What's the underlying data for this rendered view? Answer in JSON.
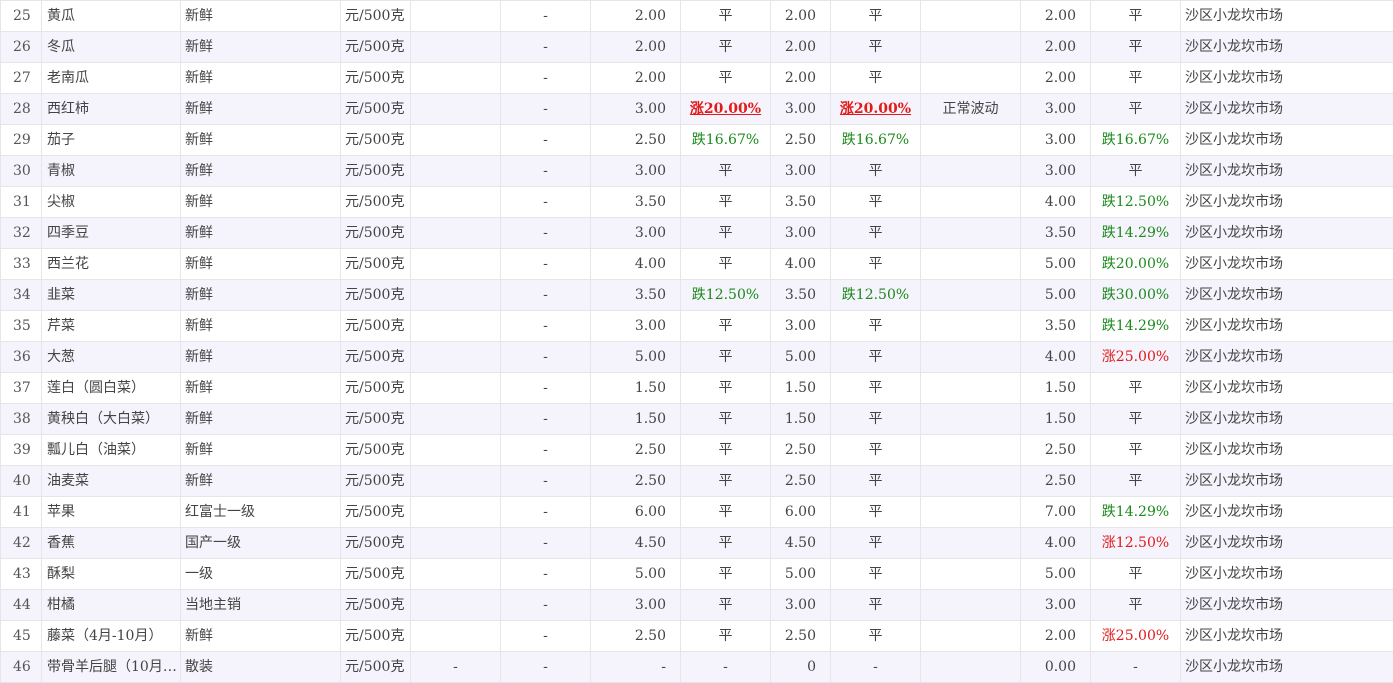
{
  "rows": [
    {
      "idx": "25",
      "name": "黄瓜",
      "spec": "新鲜",
      "unit": "元/500克",
      "b1": "",
      "b2": "-",
      "p1": "2.00",
      "c1": "平",
      "p2": "2.00",
      "c2": "平",
      "note": "",
      "p3": "2.00",
      "c3": "平",
      "market": "沙区小龙坎市场"
    },
    {
      "idx": "26",
      "name": "冬瓜",
      "spec": "新鲜",
      "unit": "元/500克",
      "b1": "",
      "b2": "-",
      "p1": "2.00",
      "c1": "平",
      "p2": "2.00",
      "c2": "平",
      "note": "",
      "p3": "2.00",
      "c3": "平",
      "market": "沙区小龙坎市场"
    },
    {
      "idx": "27",
      "name": "老南瓜",
      "spec": "新鲜",
      "unit": "元/500克",
      "b1": "",
      "b2": "-",
      "p1": "2.00",
      "c1": "平",
      "p2": "2.00",
      "c2": "平",
      "note": "",
      "p3": "2.00",
      "c3": "平",
      "market": "沙区小龙坎市场"
    },
    {
      "idx": "28",
      "name": "西红柿",
      "spec": "新鲜",
      "unit": "元/500克",
      "b1": "",
      "b2": "-",
      "p1": "3.00",
      "c1": "涨20.00%",
      "p2": "3.00",
      "c2": "涨20.00%",
      "note": "正常波动",
      "p3": "3.00",
      "c3": "平",
      "market": "沙区小龙坎市场"
    },
    {
      "idx": "29",
      "name": "茄子",
      "spec": "新鲜",
      "unit": "元/500克",
      "b1": "",
      "b2": "-",
      "p1": "2.50",
      "c1": "跌16.67%",
      "p2": "2.50",
      "c2": "跌16.67%",
      "note": "",
      "p3": "3.00",
      "c3": "跌16.67%",
      "market": "沙区小龙坎市场"
    },
    {
      "idx": "30",
      "name": "青椒",
      "spec": "新鲜",
      "unit": "元/500克",
      "b1": "",
      "b2": "-",
      "p1": "3.00",
      "c1": "平",
      "p2": "3.00",
      "c2": "平",
      "note": "",
      "p3": "3.00",
      "c3": "平",
      "market": "沙区小龙坎市场"
    },
    {
      "idx": "31",
      "name": "尖椒",
      "spec": "新鲜",
      "unit": "元/500克",
      "b1": "",
      "b2": "-",
      "p1": "3.50",
      "c1": "平",
      "p2": "3.50",
      "c2": "平",
      "note": "",
      "p3": "4.00",
      "c3": "跌12.50%",
      "market": "沙区小龙坎市场"
    },
    {
      "idx": "32",
      "name": "四季豆",
      "spec": "新鲜",
      "unit": "元/500克",
      "b1": "",
      "b2": "-",
      "p1": "3.00",
      "c1": "平",
      "p2": "3.00",
      "c2": "平",
      "note": "",
      "p3": "3.50",
      "c3": "跌14.29%",
      "market": "沙区小龙坎市场"
    },
    {
      "idx": "33",
      "name": "西兰花",
      "spec": "新鲜",
      "unit": "元/500克",
      "b1": "",
      "b2": "-",
      "p1": "4.00",
      "c1": "平",
      "p2": "4.00",
      "c2": "平",
      "note": "",
      "p3": "5.00",
      "c3": "跌20.00%",
      "market": "沙区小龙坎市场"
    },
    {
      "idx": "34",
      "name": "韭菜",
      "spec": "新鲜",
      "unit": "元/500克",
      "b1": "",
      "b2": "-",
      "p1": "3.50",
      "c1": "跌12.50%",
      "p2": "3.50",
      "c2": "跌12.50%",
      "note": "",
      "p3": "5.00",
      "c3": "跌30.00%",
      "market": "沙区小龙坎市场"
    },
    {
      "idx": "35",
      "name": "芹菜",
      "spec": "新鲜",
      "unit": "元/500克",
      "b1": "",
      "b2": "-",
      "p1": "3.00",
      "c1": "平",
      "p2": "3.00",
      "c2": "平",
      "note": "",
      "p3": "3.50",
      "c3": "跌14.29%",
      "market": "沙区小龙坎市场"
    },
    {
      "idx": "36",
      "name": "大葱",
      "spec": "新鲜",
      "unit": "元/500克",
      "b1": "",
      "b2": "-",
      "p1": "5.00",
      "c1": "平",
      "p2": "5.00",
      "c2": "平",
      "note": "",
      "p3": "4.00",
      "c3": "涨25.00%",
      "market": "沙区小龙坎市场"
    },
    {
      "idx": "37",
      "name": "莲白（圆白菜）",
      "spec": "新鲜",
      "unit": "元/500克",
      "b1": "",
      "b2": "-",
      "p1": "1.50",
      "c1": "平",
      "p2": "1.50",
      "c2": "平",
      "note": "",
      "p3": "1.50",
      "c3": "平",
      "market": "沙区小龙坎市场"
    },
    {
      "idx": "38",
      "name": "黄秧白（大白菜）",
      "spec": "新鲜",
      "unit": "元/500克",
      "b1": "",
      "b2": "-",
      "p1": "1.50",
      "c1": "平",
      "p2": "1.50",
      "c2": "平",
      "note": "",
      "p3": "1.50",
      "c3": "平",
      "market": "沙区小龙坎市场"
    },
    {
      "idx": "39",
      "name": "瓢儿白（油菜）",
      "spec": "新鲜",
      "unit": "元/500克",
      "b1": "",
      "b2": "-",
      "p1": "2.50",
      "c1": "平",
      "p2": "2.50",
      "c2": "平",
      "note": "",
      "p3": "2.50",
      "c3": "平",
      "market": "沙区小龙坎市场"
    },
    {
      "idx": "40",
      "name": "油麦菜",
      "spec": "新鲜",
      "unit": "元/500克",
      "b1": "",
      "b2": "-",
      "p1": "2.50",
      "c1": "平",
      "p2": "2.50",
      "c2": "平",
      "note": "",
      "p3": "2.50",
      "c3": "平",
      "market": "沙区小龙坎市场"
    },
    {
      "idx": "41",
      "name": "苹果",
      "spec": "红富士一级",
      "unit": "元/500克",
      "b1": "",
      "b2": "-",
      "p1": "6.00",
      "c1": "平",
      "p2": "6.00",
      "c2": "平",
      "note": "",
      "p3": "7.00",
      "c3": "跌14.29%",
      "market": "沙区小龙坎市场"
    },
    {
      "idx": "42",
      "name": "香蕉",
      "spec": "国产一级",
      "unit": "元/500克",
      "b1": "",
      "b2": "-",
      "p1": "4.50",
      "c1": "平",
      "p2": "4.50",
      "c2": "平",
      "note": "",
      "p3": "4.00",
      "c3": "涨12.50%",
      "market": "沙区小龙坎市场"
    },
    {
      "idx": "43",
      "name": "酥梨",
      "spec": "一级",
      "unit": "元/500克",
      "b1": "",
      "b2": "-",
      "p1": "5.00",
      "c1": "平",
      "p2": "5.00",
      "c2": "平",
      "note": "",
      "p3": "5.00",
      "c3": "平",
      "market": "沙区小龙坎市场"
    },
    {
      "idx": "44",
      "name": "柑橘",
      "spec": "当地主销",
      "unit": "元/500克",
      "b1": "",
      "b2": "-",
      "p1": "3.00",
      "c1": "平",
      "p2": "3.00",
      "c2": "平",
      "note": "",
      "p3": "3.00",
      "c3": "平",
      "market": "沙区小龙坎市场"
    },
    {
      "idx": "45",
      "name": "藤菜（4月-10月）",
      "spec": "新鲜",
      "unit": "元/500克",
      "b1": "",
      "b2": "-",
      "p1": "2.50",
      "c1": "平",
      "p2": "2.50",
      "c2": "平",
      "note": "",
      "p3": "2.00",
      "c3": "涨25.00%",
      "market": "沙区小龙坎市场"
    },
    {
      "idx": "46",
      "name": "带骨羊后腿（10月-…",
      "spec": "散装",
      "unit": "元/500克",
      "b1": "-",
      "b2": "-",
      "p1": "-",
      "c1": "-",
      "p2": "0",
      "c2": "-",
      "note": "",
      "p3": "0.00",
      "c3": "-",
      "market": "沙区小龙坎市场"
    }
  ]
}
